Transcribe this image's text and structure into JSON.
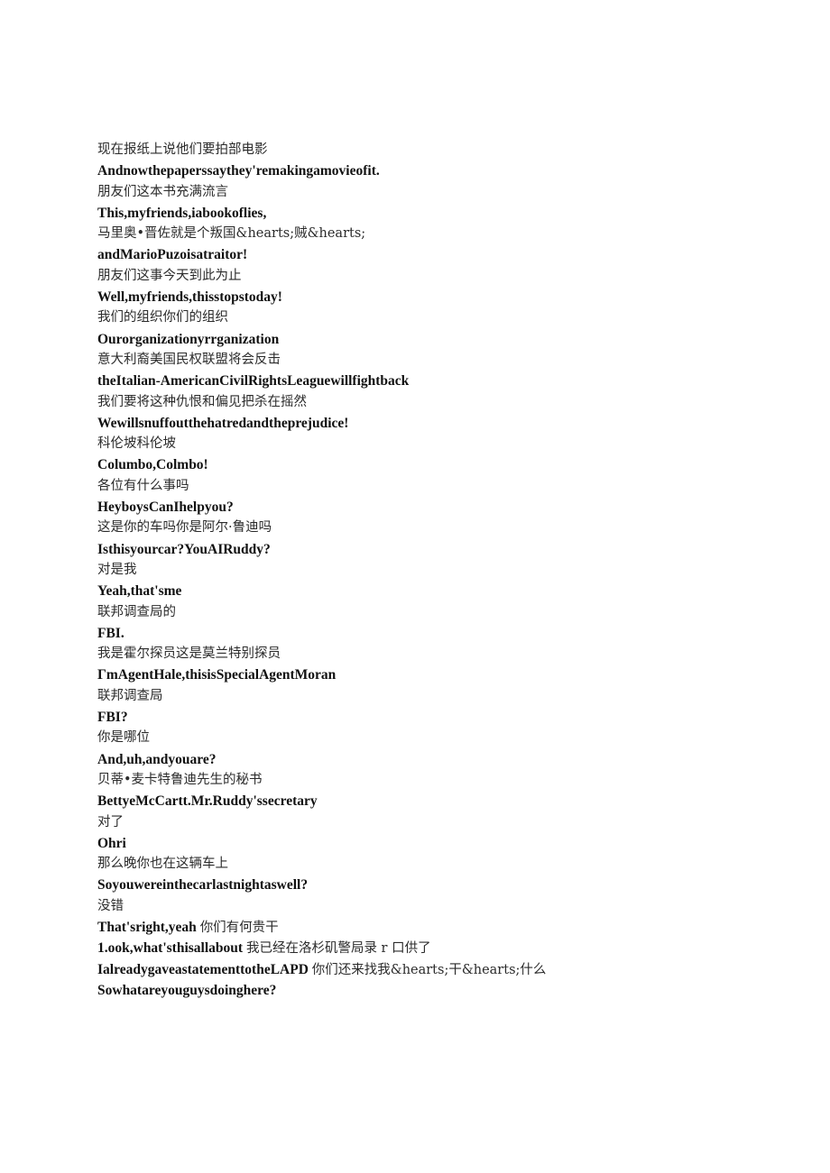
{
  "document": {
    "background_color": "#ffffff",
    "text_color_chinese": "#2b2b2b",
    "text_color_english": "#111111",
    "lines": [
      {
        "id": "l01",
        "kind": "cn",
        "text": "现在报纸上说他们要拍部电影"
      },
      {
        "id": "l02",
        "kind": "en",
        "text": "Andnowthepaperssaythey'remakingamovieofit."
      },
      {
        "id": "l03",
        "kind": "cn",
        "text": "朋友们这本书充满流言"
      },
      {
        "id": "l04",
        "kind": "en",
        "text": "This,myfriends,iabookoflies,"
      },
      {
        "id": "l05",
        "kind": "cn",
        "text": "马里奥•晋佐就是个叛国&hearts;贼&hearts;"
      },
      {
        "id": "l06",
        "kind": "en",
        "text": "andMarioPuzoisatraitor!"
      },
      {
        "id": "l07",
        "kind": "cn",
        "text": "朋友们这事今天到此为止"
      },
      {
        "id": "l08",
        "kind": "en",
        "text": "Well,myfriends,thisstopstoday!"
      },
      {
        "id": "l09",
        "kind": "cn",
        "text": "我们的组织你们的组织"
      },
      {
        "id": "l10",
        "kind": "en",
        "text": "Ourorganizationyrrganization"
      },
      {
        "id": "l11",
        "kind": "cn",
        "text": "意大利裔美国民权联盟将会反击"
      },
      {
        "id": "l12",
        "kind": "en",
        "text": "theItalian-AmericanCivilRightsLeaguewillfightback"
      },
      {
        "id": "l13",
        "kind": "cn",
        "text": "我们要将这种仇恨和偏见把杀在摇然"
      },
      {
        "id": "l14",
        "kind": "en",
        "text": "Wewillsnuffoutthehatredandtheprejudice!"
      },
      {
        "id": "l15",
        "kind": "cn",
        "text": "科伦坡科伦坡"
      },
      {
        "id": "l16",
        "kind": "en",
        "text": "Columbo,Colmbo!"
      },
      {
        "id": "l17",
        "kind": "cn",
        "text": "各位有什么事吗"
      },
      {
        "id": "l18",
        "kind": "en",
        "text": "HeyboysCanIhelpyou?"
      },
      {
        "id": "l19",
        "kind": "cn",
        "text": "这是你的车吗你是阿尔·鲁迪吗"
      },
      {
        "id": "l20",
        "kind": "en",
        "text": "Isthisyourcar?YouAIRuddy?"
      },
      {
        "id": "l21",
        "kind": "cn",
        "text": "对是我"
      },
      {
        "id": "l22",
        "kind": "en",
        "text": "Yeah,that'sme"
      },
      {
        "id": "l23",
        "kind": "cn",
        "text": "联邦调查局的"
      },
      {
        "id": "l24",
        "kind": "en",
        "text": "FBI."
      },
      {
        "id": "l25",
        "kind": "cn",
        "text": "我是霍尔探员这是莫兰特别探员"
      },
      {
        "id": "l26",
        "kind": "en",
        "text": "ΓmAgentHale,thisisSpecialAgentMoran"
      },
      {
        "id": "l27",
        "kind": "cn",
        "text": "联邦调查局"
      },
      {
        "id": "l28",
        "kind": "en",
        "text": "FBI?"
      },
      {
        "id": "l29",
        "kind": "cn",
        "text": "你是哪位"
      },
      {
        "id": "l30",
        "kind": "en",
        "text": "And,uh,andyouare?"
      },
      {
        "id": "l31",
        "kind": "cn",
        "text": "贝蒂•麦卡特鲁迪先生的秘书"
      },
      {
        "id": "l32",
        "kind": "en",
        "text": "BettyeMcCartt.Mr.Ruddy'ssecretary"
      },
      {
        "id": "l33",
        "kind": "cn",
        "text": "对了"
      },
      {
        "id": "l34",
        "kind": "en",
        "text": "Ohri"
      },
      {
        "id": "l35",
        "kind": "cn",
        "text": "那么晚你也在这辆车上"
      },
      {
        "id": "l36",
        "kind": "en",
        "text": "Soyouwereinthecarlastnightaswell?"
      },
      {
        "id": "l37",
        "kind": "cn",
        "text": "没错"
      },
      {
        "id": "l38",
        "kind": "mixed",
        "segments": [
          {
            "script": "en",
            "text": "That'sright,yeah "
          },
          {
            "script": "cn",
            "text": "你们有何贵干"
          }
        ]
      },
      {
        "id": "l39",
        "kind": "mixed",
        "segments": [
          {
            "script": "en",
            "text": "1.ook,what'sthisallabout "
          },
          {
            "script": "cn",
            "text": "我已经在洛杉矶警局录 r 口供了"
          }
        ]
      },
      {
        "id": "l40",
        "kind": "mixed",
        "segments": [
          {
            "script": "en",
            "text": "IalreadygaveastatementtotheLAPD "
          },
          {
            "script": "cn",
            "text": "你们还来找我&hearts;干&hearts;什么"
          }
        ]
      },
      {
        "id": "l41",
        "kind": "en",
        "text": "Sowhatareyouguysdoinghere?"
      }
    ]
  }
}
